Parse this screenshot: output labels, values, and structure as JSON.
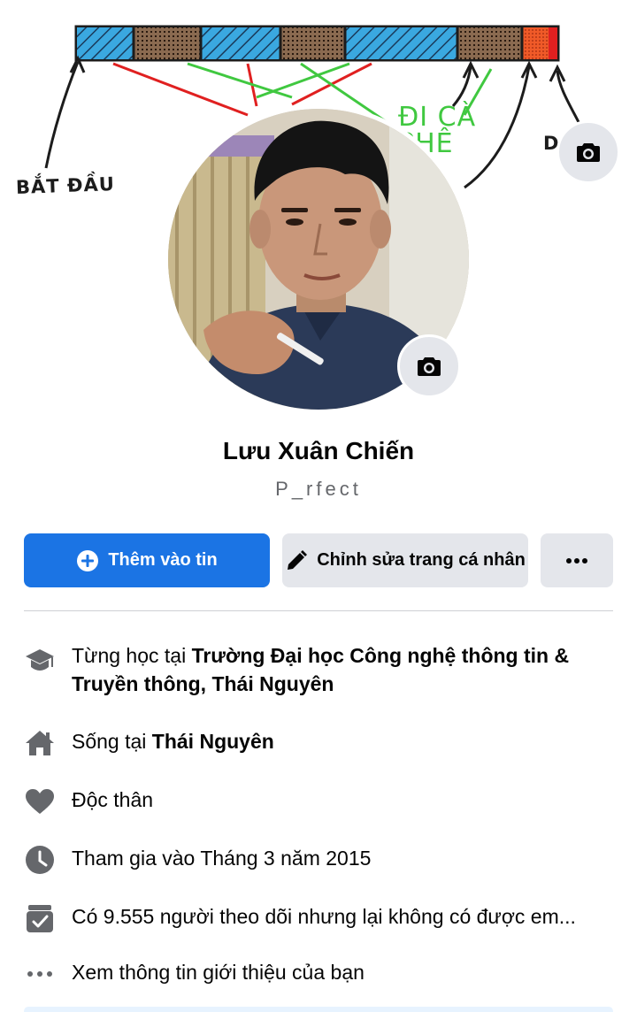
{
  "cover": {
    "label_start": "BẮT ĐẦU",
    "label_mid": "ĐI CÀ PHÊ",
    "label_end": "DE"
  },
  "profile": {
    "name": "Lưu Xuân Chiến",
    "nickname": "P_rfect"
  },
  "actions": {
    "add_story_label": "Thêm vào tin",
    "edit_profile_label": "Chỉnh sửa trang cá nhân",
    "more_label": "···"
  },
  "intro": {
    "education_prefix": "Từng học tại ",
    "education_school": "Trường Đại học Công nghệ thông tin & Truyền thông, Thái Nguyên",
    "lives_prefix": "Sống tại ",
    "lives_place": "Thái Nguyên",
    "relationship": "Độc thân",
    "joined": "Tham gia vào Tháng 3 năm 2015",
    "followers": "Có 9.555 người theo dõi nhưng lại không có được em...",
    "see_about": "Xem thông tin giới thiệu của bạn"
  },
  "colors": {
    "primary": "#1b74e4",
    "secondary_bg": "#e4e6eb",
    "icon_gray": "#65676b",
    "cover_blue": "#3aa8e0",
    "cover_red": "#e02020",
    "cover_green": "#40c840",
    "cover_orange": "#f05a28"
  },
  "icons": {
    "add": "plus-circle-icon",
    "edit": "pencil-icon",
    "more": "more-dots-icon",
    "camera": "camera-icon",
    "education": "graduation-cap-icon",
    "home": "home-icon",
    "heart": "heart-icon",
    "clock": "clock-icon",
    "followers": "followers-icon",
    "about": "more-dots-icon"
  }
}
